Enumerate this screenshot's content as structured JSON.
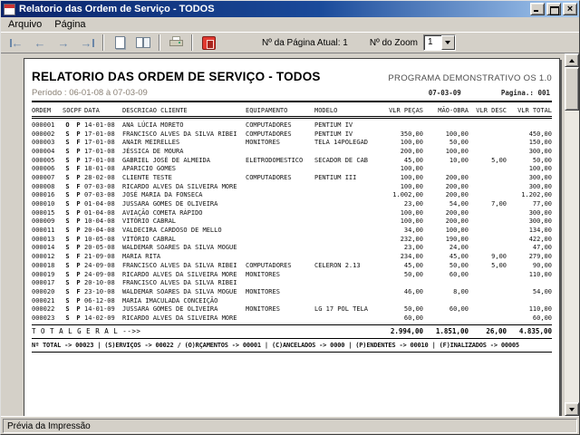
{
  "window": {
    "title": "Relatorio das Ordem de Serviço - TODOS",
    "menu": {
      "arquivo": "Arquivo",
      "pagina": "Página"
    },
    "toolbar": {
      "page_current_label": "Nº da Página Atual: 1",
      "zoom_label": "Nº do Zoom",
      "zoom_value": "1"
    },
    "status": "Prévia da Impressão"
  },
  "report": {
    "title": "RELATORIO DAS ORDEM DE SERVIÇO - TODOS",
    "program": "PROGRAMA DEMONSTRATIVO OS 1.0",
    "period": "Período : 06-01-08 à 07-03-09",
    "header_date": "07-03-09",
    "header_page": "Pagina.: 001",
    "columns": [
      "ORDEM",
      "SOCPF",
      "DATA",
      "DESCRICAO CLIENTE",
      "EQUIPAMENTO",
      "MODELO",
      "VLR PEÇAS",
      "MÃO-OBRA",
      "VLR DESC",
      "VLR TOTAL"
    ],
    "rows": [
      {
        "ordem": "000001",
        "st": "O",
        "pf": "P",
        "data": "14-01-08",
        "cliente": "ANA LÚCIA MORETO",
        "equip": "COMPUTADORES",
        "modelo": "PENTIUM IV",
        "pecas": "",
        "mao": "",
        "desc": "",
        "total": ""
      },
      {
        "ordem": "000002",
        "st": "S",
        "pf": "P",
        "data": "17-01-08",
        "cliente": "FRANCISCO ALVES DA SILVA RIBEI",
        "equip": "COMPUTADORES",
        "modelo": "PENTIUM IV",
        "pecas": "350,00",
        "mao": "100,00",
        "desc": "",
        "total": "450,00"
      },
      {
        "ordem": "000003",
        "st": "S",
        "pf": "F",
        "data": "17-01-08",
        "cliente": "ANAIR MEIRELLES",
        "equip": "MONITORES",
        "modelo": "TELA 14POLEGAD",
        "pecas": "100,00",
        "mao": "50,00",
        "desc": "",
        "total": "150,00"
      },
      {
        "ordem": "000004",
        "st": "S",
        "pf": "P",
        "data": "17-01-08",
        "cliente": "JÉSSICA DE MOURA",
        "equip": "",
        "modelo": "",
        "pecas": "200,00",
        "mao": "100,00",
        "desc": "",
        "total": "300,00"
      },
      {
        "ordem": "000005",
        "st": "S",
        "pf": "P",
        "data": "17-01-08",
        "cliente": "GABRIEL JOSÉ DE ALMEIDA",
        "equip": "ELETRODOMESTICO",
        "modelo": "SECADOR DE CAB",
        "pecas": "45,00",
        "mao": "10,00",
        "desc": "5,00",
        "total": "50,00"
      },
      {
        "ordem": "000006",
        "st": "S",
        "pf": "F",
        "data": "18-01-08",
        "cliente": "APARICIO GOMES",
        "equip": "",
        "modelo": "",
        "pecas": "100,00",
        "mao": "",
        "desc": "",
        "total": "100,00"
      },
      {
        "ordem": "000007",
        "st": "S",
        "pf": "P",
        "data": "28-02-08",
        "cliente": "CLIENTE TESTE",
        "equip": "COMPUTADORES",
        "modelo": "PENTIUM III",
        "pecas": "100,00",
        "mao": "200,00",
        "desc": "",
        "total": "300,00"
      },
      {
        "ordem": "000008",
        "st": "S",
        "pf": "F",
        "data": "07-03-08",
        "cliente": "RICARDO ALVES DA SILVEIRA MORE",
        "equip": "",
        "modelo": "",
        "pecas": "100,00",
        "mao": "200,00",
        "desc": "",
        "total": "300,00"
      },
      {
        "ordem": "000016",
        "st": "S",
        "pf": "P",
        "data": "07-03-08",
        "cliente": "JOSÉ MARIA DA FONSECA",
        "equip": "",
        "modelo": "",
        "pecas": "1.002,00",
        "mao": "200,00",
        "desc": "",
        "total": "1.202,00"
      },
      {
        "ordem": "000010",
        "st": "S",
        "pf": "P",
        "data": "01-04-08",
        "cliente": "JUSSARA GOMES DE OLIVEIRA",
        "equip": "",
        "modelo": "",
        "pecas": "23,00",
        "mao": "54,00",
        "desc": "7,00",
        "total": "77,00"
      },
      {
        "ordem": "000015",
        "st": "S",
        "pf": "P",
        "data": "01-04-08",
        "cliente": "AVIAÇÃO COMETA RÁPIDO",
        "equip": "",
        "modelo": "",
        "pecas": "100,00",
        "mao": "200,00",
        "desc": "",
        "total": "300,00"
      },
      {
        "ordem": "000009",
        "st": "S",
        "pf": "P",
        "data": "10-04-08",
        "cliente": "VITÓRIO CABRAL",
        "equip": "",
        "modelo": "",
        "pecas": "100,00",
        "mao": "200,00",
        "desc": "",
        "total": "300,00"
      },
      {
        "ordem": "000011",
        "st": "S",
        "pf": "P",
        "data": "20-04-08",
        "cliente": "VALDECIRA CARDOSO DE MELLO",
        "equip": "",
        "modelo": "",
        "pecas": "34,00",
        "mao": "100,00",
        "desc": "",
        "total": "134,00"
      },
      {
        "ordem": "000013",
        "st": "S",
        "pf": "P",
        "data": "10-05-08",
        "cliente": "VITÓRIO CABRAL",
        "equip": "",
        "modelo": "",
        "pecas": "232,00",
        "mao": "190,00",
        "desc": "",
        "total": "422,00"
      },
      {
        "ordem": "000014",
        "st": "S",
        "pf": "P",
        "data": "20-05-08",
        "cliente": "WALDEMAR SOARES DA SILVA MOGUE",
        "equip": "",
        "modelo": "",
        "pecas": "23,00",
        "mao": "24,00",
        "desc": "",
        "total": "47,00"
      },
      {
        "ordem": "000012",
        "st": "S",
        "pf": "F",
        "data": "21-09-08",
        "cliente": "MARIA RITA",
        "equip": "",
        "modelo": "",
        "pecas": "234,00",
        "mao": "45,00",
        "desc": "9,00",
        "total": "279,00"
      },
      {
        "ordem": "000018",
        "st": "S",
        "pf": "P",
        "data": "24-09-08",
        "cliente": "FRANCISCO ALVES DA SILVA RIBEI",
        "equip": "COMPUTADORES",
        "modelo": "CELERON 2.13",
        "pecas": "45,00",
        "mao": "50,00",
        "desc": "5,00",
        "total": "90,00"
      },
      {
        "ordem": "000019",
        "st": "S",
        "pf": "P",
        "data": "24-09-08",
        "cliente": "RICARDO ALVES DA SILVEIRA MORE",
        "equip": "MONITORES",
        "modelo": "",
        "pecas": "50,00",
        "mao": "60,00",
        "desc": "",
        "total": "110,00"
      },
      {
        "ordem": "000017",
        "st": "S",
        "pf": "P",
        "data": "20-10-08",
        "cliente": "FRANCISCO ALVES DA SILVA RIBEI",
        "equip": "",
        "modelo": "",
        "pecas": "",
        "mao": "",
        "desc": "",
        "total": ""
      },
      {
        "ordem": "000020",
        "st": "S",
        "pf": "F",
        "data": "23-10-08",
        "cliente": "WALDEMAR SOARES DA SILVA MOGUE",
        "equip": "MONITORES",
        "modelo": "",
        "pecas": "46,00",
        "mao": "8,00",
        "desc": "",
        "total": "54,00"
      },
      {
        "ordem": "000021",
        "st": "S",
        "pf": "P",
        "data": "06-12-08",
        "cliente": "MARIA IMACULADA CONCEIÇÃO",
        "equip": "",
        "modelo": "",
        "pecas": "",
        "mao": "",
        "desc": "",
        "total": ""
      },
      {
        "ordem": "000022",
        "st": "S",
        "pf": "P",
        "data": "14-01-09",
        "cliente": "JUSSARA GOMES DE OLIVEIRA",
        "equip": "MONITORES",
        "modelo": "LG 17 POL TELA",
        "pecas": "50,00",
        "mao": "60,00",
        "desc": "",
        "total": "110,00"
      },
      {
        "ordem": "000023",
        "st": "S",
        "pf": "P",
        "data": "14-02-09",
        "cliente": "RICARDO ALVES DA SILVEIRA MORE",
        "equip": "",
        "modelo": "",
        "pecas": "60,00",
        "mao": "",
        "desc": "",
        "total": "60,00"
      }
    ],
    "total_label": "T O T A L   G E R A L   -->>",
    "totals": {
      "pecas": "2.994,00",
      "mao_obra": "1.851,00",
      "desc": "26,00",
      "total": "4.835,00"
    },
    "summary": "Nº TOTAL -> 00023 | (S)ERVIÇOS -> 00022 / (O)RÇAMENTOS -> 00001 | (C)ANCELADOS -> 0000 | (P)ENDENTES -> 00010 | (F)INALIZADOS -> 00005"
  }
}
